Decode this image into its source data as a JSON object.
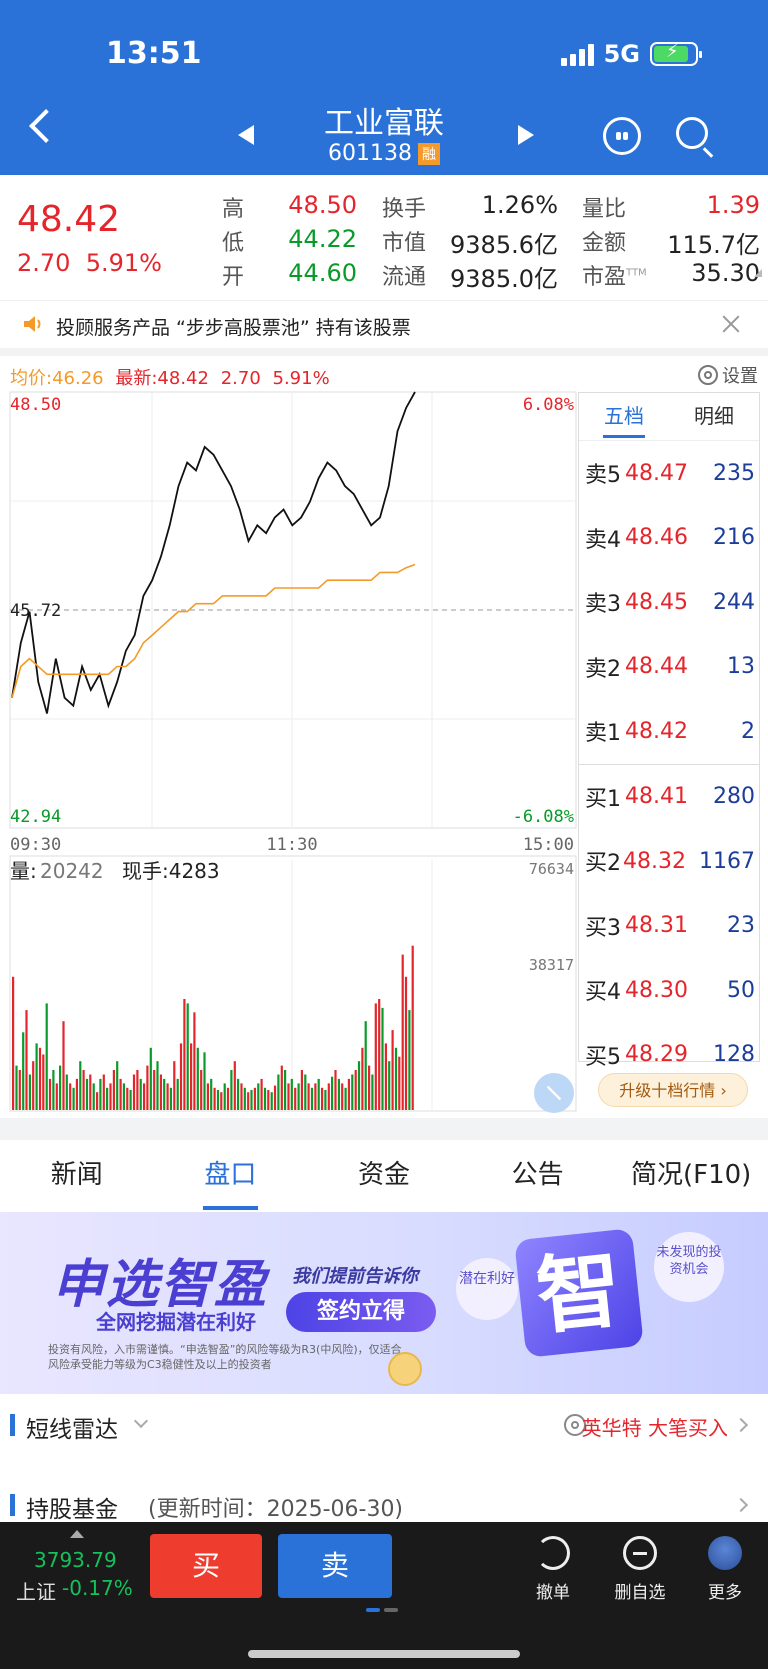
{
  "status": {
    "time": "13:51",
    "network": "5G"
  },
  "header": {
    "title": "工业富联",
    "code": "601138",
    "tag": "融"
  },
  "quote": {
    "price": "48.42",
    "change": "2.70",
    "change_pct": "5.91%",
    "stats": [
      {
        "label": "高",
        "value": "48.50",
        "color": "red"
      },
      {
        "label": "换手",
        "value": "1.26%",
        "color": "dark"
      },
      {
        "label": "量比",
        "value": "1.39",
        "color": "red"
      },
      {
        "label": "低",
        "value": "44.22",
        "color": "green"
      },
      {
        "label": "市值",
        "value": "9385.6亿",
        "color": "dark"
      },
      {
        "label": "金额",
        "value": "115.7亿",
        "color": "dark"
      },
      {
        "label": "开",
        "value": "44.60",
        "color": "green"
      },
      {
        "label": "流通",
        "value": "9385.0亿",
        "color": "dark"
      },
      {
        "label": "市盈",
        "value": "35.30",
        "color": "dark"
      }
    ],
    "pe_sup": "TTM"
  },
  "notice": {
    "text": "投顾服务产品 “步步高股票池” 持有该股票"
  },
  "chart_head": {
    "avg_label": "均价:",
    "avg_value": "46.26",
    "last_label": "最新:",
    "last_value": "48.42",
    "change": "2.70",
    "change_pct": "5.91%",
    "settings_label": "设置"
  },
  "chart_data": {
    "type": "line",
    "price_axis": {
      "top": "48.50",
      "mid": "45.72",
      "bottom": "42.94",
      "top_pct": "6.08%",
      "bottom_pct": "-6.08%"
    },
    "ylim": [
      42.94,
      48.5
    ],
    "time_ticks": [
      "09:30",
      "11:30",
      "15:00"
    ],
    "series": [
      {
        "name": "最新",
        "color": "#111111",
        "values": [
          44.6,
          45.3,
          45.7,
          44.8,
          44.4,
          45.1,
          44.6,
          44.5,
          45.0,
          44.7,
          44.9,
          44.5,
          44.8,
          45.2,
          45.4,
          45.9,
          46.1,
          46.4,
          46.8,
          47.3,
          47.6,
          47.5,
          47.8,
          47.7,
          47.5,
          47.3,
          47.0,
          46.6,
          46.8,
          46.7,
          46.9,
          47.0,
          46.8,
          46.9,
          47.1,
          47.4,
          47.6,
          47.5,
          47.3,
          47.2,
          47.0,
          46.8,
          46.9,
          47.3,
          48.0,
          48.3,
          48.5
        ]
      },
      {
        "name": "均价",
        "color": "#f39a2b",
        "values": [
          44.6,
          45.0,
          45.1,
          45.0,
          44.9,
          44.9,
          44.9,
          44.9,
          44.9,
          44.9,
          44.9,
          44.9,
          45.0,
          45.0,
          45.1,
          45.3,
          45.4,
          45.5,
          45.6,
          45.7,
          45.7,
          45.8,
          45.8,
          45.8,
          45.9,
          45.9,
          45.9,
          45.9,
          45.9,
          45.9,
          46.0,
          46.0,
          46.0,
          46.0,
          46.0,
          46.0,
          46.1,
          46.1,
          46.1,
          46.1,
          46.1,
          46.1,
          46.2,
          46.2,
          46.2,
          46.26,
          46.3
        ]
      }
    ],
    "volume": {
      "label": "量:",
      "value": "20242",
      "hand_label": "现手:",
      "hand_value": "4283",
      "ticks": [
        "76634",
        "38317"
      ],
      "max": 76634,
      "values": [
        60,
        20,
        18,
        35,
        45,
        16,
        22,
        30,
        28,
        25,
        48,
        14,
        18,
        12,
        20,
        40,
        16,
        12,
        10,
        14,
        22,
        18,
        14,
        16,
        12,
        8,
        14,
        16,
        10,
        12,
        18,
        22,
        14,
        12,
        10,
        9,
        16,
        18,
        14,
        12,
        20,
        28,
        18,
        22,
        16,
        14,
        12,
        10,
        22,
        14,
        30,
        50,
        48,
        30,
        44,
        28,
        18,
        26,
        12,
        14,
        10,
        9,
        8,
        12,
        10,
        18,
        22,
        14,
        12,
        10,
        8,
        9,
        10,
        12,
        14,
        10,
        9,
        8,
        11,
        16,
        20,
        18,
        12,
        14,
        10,
        12,
        18,
        16,
        12,
        10,
        12,
        14,
        10,
        9,
        12,
        15,
        18,
        14,
        12,
        10,
        14,
        16,
        18,
        22,
        28,
        40,
        20,
        16,
        48,
        50,
        46,
        30,
        22,
        36,
        28,
        24,
        70,
        60,
        45,
        74
      ],
      "colors": [
        "r",
        "g",
        "r",
        "g",
        "r",
        "g",
        "r",
        "g",
        "r",
        "r",
        "g",
        "r",
        "g",
        "r",
        "g",
        "r",
        "g",
        "r",
        "g",
        "r",
        "g",
        "r",
        "g",
        "r",
        "g",
        "r",
        "g",
        "r",
        "g",
        "r",
        "r",
        "g",
        "r",
        "g",
        "r",
        "g",
        "r",
        "r",
        "g",
        "r",
        "r",
        "g",
        "r",
        "g",
        "r",
        "g",
        "r",
        "g",
        "r",
        "g",
        "r",
        "r",
        "g",
        "r",
        "r",
        "g",
        "r",
        "g",
        "r",
        "g",
        "r",
        "g",
        "r",
        "g",
        "r",
        "g",
        "r",
        "g",
        "r",
        "g",
        "r",
        "g",
        "r",
        "g",
        "r",
        "g",
        "r",
        "g",
        "r",
        "g",
        "r",
        "g",
        "r",
        "g",
        "r",
        "g",
        "r",
        "g",
        "r",
        "g",
        "r",
        "g",
        "r",
        "g",
        "r",
        "g",
        "r",
        "g",
        "r",
        "g",
        "r",
        "g",
        "r",
        "g",
        "r",
        "g",
        "r",
        "g",
        "r",
        "r",
        "g",
        "r",
        "g",
        "r",
        "g",
        "r",
        "r",
        "r",
        "g",
        "r"
      ]
    }
  },
  "book": {
    "tabs": [
      "五档",
      "明细"
    ],
    "asks": [
      {
        "label": "卖5",
        "price": "48.47",
        "vol": "235"
      },
      {
        "label": "卖4",
        "price": "48.46",
        "vol": "216"
      },
      {
        "label": "卖3",
        "price": "48.45",
        "vol": "244"
      },
      {
        "label": "卖2",
        "price": "48.44",
        "vol": "13"
      },
      {
        "label": "卖1",
        "price": "48.42",
        "vol": "2"
      }
    ],
    "bids": [
      {
        "label": "买1",
        "price": "48.41",
        "vol": "280"
      },
      {
        "label": "买2",
        "price": "48.32",
        "vol": "1167"
      },
      {
        "label": "买3",
        "price": "48.31",
        "vol": "23"
      },
      {
        "label": "买4",
        "price": "48.30",
        "vol": "50"
      },
      {
        "label": "买5",
        "price": "48.29",
        "vol": "128"
      }
    ],
    "upgrade_label": "升级十档行情 ›"
  },
  "tabs": [
    "新闻",
    "盘口",
    "资金",
    "公告",
    "简况(F10)"
  ],
  "banner": {
    "title": "申选智盈",
    "subtitle": "全网挖掘潜在利好",
    "tell": "我们提前告诉你",
    "button": "签约立得",
    "risk": "投资有风险，入市需谨慎。“申选智盈”的风险等级为R3(中风险)，仅适合风险承受能力等级为C3稳健性及以上的投资者",
    "bubble1": "潜在利好",
    "zhi": "智",
    "bubble2": "未发现的投资机会"
  },
  "sections": {
    "radar_title": "短线雷达",
    "radar_alert": "英华特 大笔买入",
    "fund_title": "持股基金",
    "fund_sub": "(更新时间：2025-06-30)"
  },
  "bottom": {
    "index_value": "3793.79",
    "index_name": "上证",
    "index_change": "-0.17%",
    "buy": "买",
    "sell": "卖",
    "actions": [
      "撤单",
      "删自选",
      "更多"
    ]
  }
}
